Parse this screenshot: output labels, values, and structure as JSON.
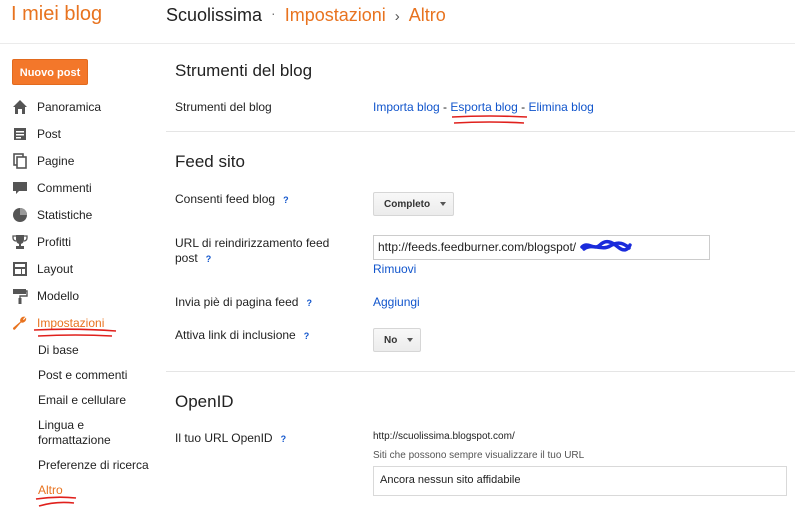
{
  "header": {
    "app_title": "I miei blog",
    "blog_name": "Scuolissima",
    "section": "Impostazioni",
    "subsection": "Altro",
    "sep_dot": "·",
    "sep_arrow": "›"
  },
  "sidebar": {
    "new_post_label": "Nuovo post",
    "items": [
      {
        "label": "Panoramica",
        "icon": "home-icon"
      },
      {
        "label": "Post",
        "icon": "posts-icon"
      },
      {
        "label": "Pagine",
        "icon": "pages-icon"
      },
      {
        "label": "Commenti",
        "icon": "comments-icon"
      },
      {
        "label": "Statistiche",
        "icon": "stats-icon"
      },
      {
        "label": "Profitti",
        "icon": "trophy-icon"
      },
      {
        "label": "Layout",
        "icon": "layout-icon"
      },
      {
        "label": "Modello",
        "icon": "paint-roller-icon"
      },
      {
        "label": "Impostazioni",
        "icon": "wrench-icon",
        "active": true
      }
    ],
    "subitems": [
      {
        "label": "Di base"
      },
      {
        "label": "Post e commenti"
      },
      {
        "label": "Email e cellulare"
      },
      {
        "label": "Lingua e formattazione"
      },
      {
        "label": "Preferenze di ricerca"
      },
      {
        "label": "Altro",
        "active": true
      }
    ]
  },
  "tools": {
    "title": "Strumenti del blog",
    "row_label": "Strumenti del blog",
    "import_link": "Importa blog",
    "export_link": "Esporta blog",
    "delete_link": "Elimina blog",
    "sep": "-"
  },
  "feed": {
    "title": "Feed sito",
    "allow_label": "Consenti feed blog",
    "allow_value": "Completo",
    "redirect_label": "URL di reindirizzamento feed post",
    "redirect_value": "http://feeds.feedburner.com/blogspot/",
    "remove_link": "Rimuovi",
    "footer_label": "Invia piè di pagina feed",
    "footer_link": "Aggiungi",
    "enclosure_label": "Attiva link di inclusione",
    "enclosure_value": "No",
    "help": "?"
  },
  "openid": {
    "title": "OpenID",
    "url_label": "Il tuo URL OpenID",
    "url_value": "http://scuolissima.blogspot.com/",
    "trusted_caption": "Siti che possono sempre visualizzare il tuo URL",
    "trusted_value": "Ancora nessun sito affidabile"
  },
  "colors": {
    "accent": "#e8731f",
    "link": "#1155cc",
    "annotation": "#e0201c"
  }
}
